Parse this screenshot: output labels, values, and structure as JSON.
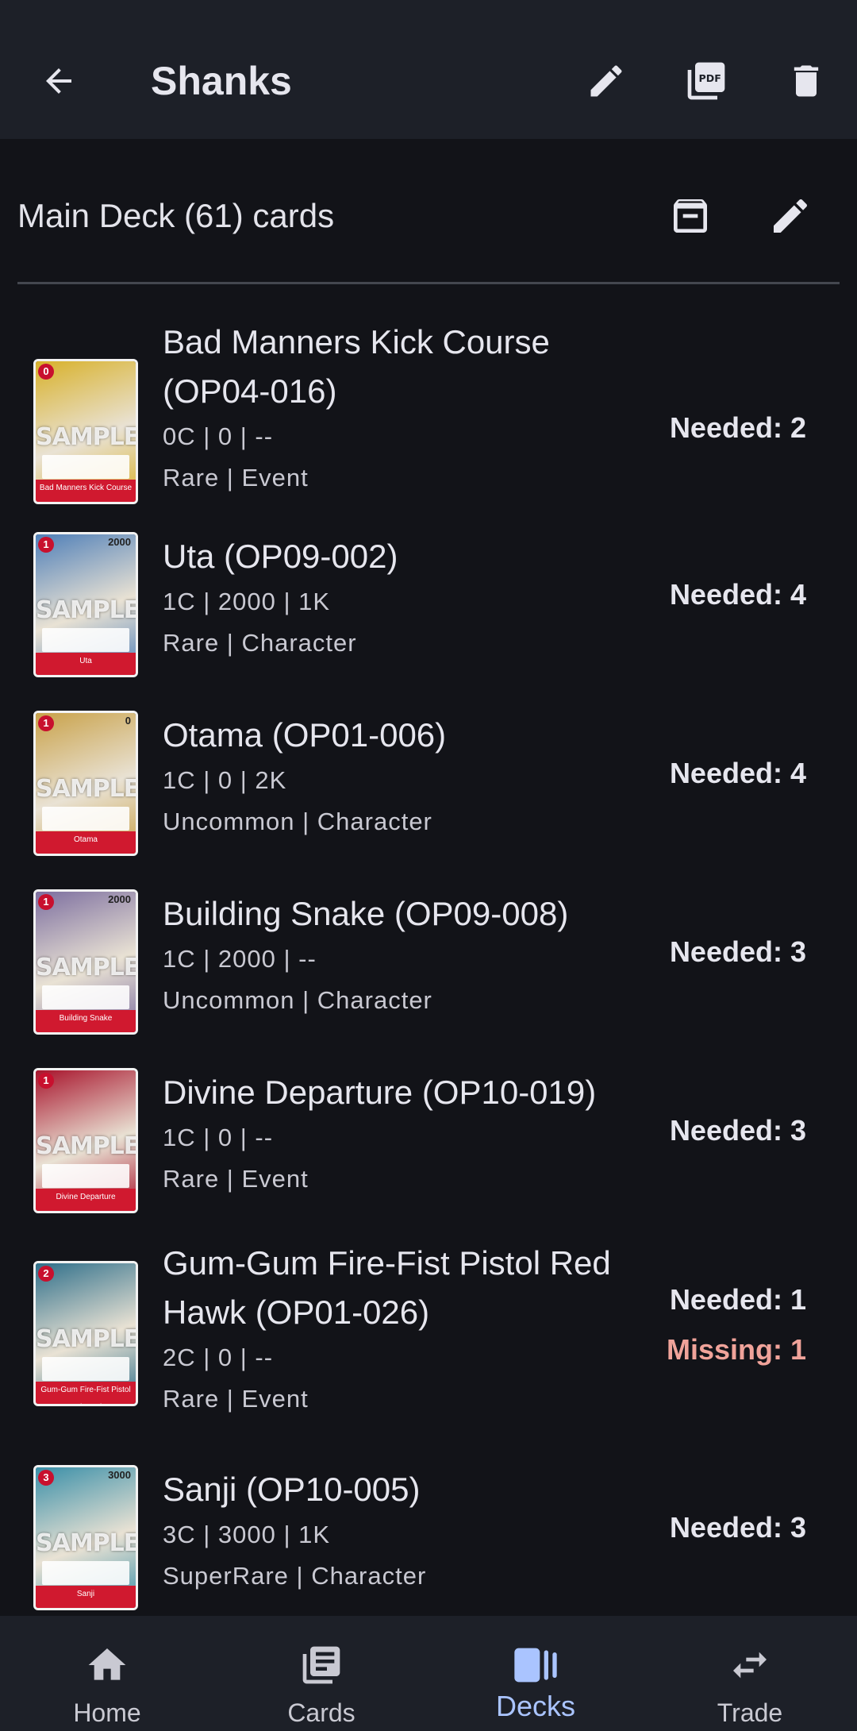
{
  "header": {
    "title": "Shanks",
    "back_icon": "arrow-left-icon",
    "actions": [
      "pencil-icon",
      "pdf-icon",
      "trash-icon"
    ]
  },
  "section": {
    "title": "Main Deck (61) cards",
    "actions": [
      "archive-icon",
      "pencil-icon"
    ]
  },
  "cards": [
    {
      "name": "Bad Manners Kick Course (OP04-016)",
      "stats": "0C | 0 | --",
      "type": "Rare | Event",
      "needed": "Needed: 2",
      "missing": "",
      "thumb_name": "Bad Manners Kick Course",
      "cost": "0",
      "power": "",
      "art_color": "#d8b12a"
    },
    {
      "name": "Uta (OP09-002)",
      "stats": "1C | 2000 | 1K",
      "type": "Rare | Character",
      "needed": "Needed: 4",
      "missing": "",
      "thumb_name": "Uta",
      "cost": "1",
      "power": "2000",
      "art_color": "#4f7fb8"
    },
    {
      "name": "Otama (OP01-006)",
      "stats": "1C | 0 | 2K",
      "type": "Uncommon | Character",
      "needed": "Needed: 4",
      "missing": "",
      "thumb_name": "Otama",
      "cost": "1",
      "power": "0",
      "art_color": "#c9a24a"
    },
    {
      "name": "Building Snake (OP09-008)",
      "stats": "1C | 2000 | --",
      "type": "Uncommon | Character",
      "needed": "Needed: 3",
      "missing": "",
      "thumb_name": "Building Snake",
      "cost": "1",
      "power": "2000",
      "art_color": "#7d6fa0"
    },
    {
      "name": "Divine Departure (OP10-019)",
      "stats": "1C | 0 | --",
      "type": "Rare | Event",
      "needed": "Needed: 3",
      "missing": "",
      "thumb_name": "Divine Departure",
      "cost": "1",
      "power": "",
      "art_color": "#a8142c"
    },
    {
      "name": "Gum-Gum Fire-Fist Pistol Red Hawk (OP01-026)",
      "stats": "2C | 0 | --",
      "type": "Rare | Event",
      "needed": "Needed: 1",
      "missing": "Missing: 1",
      "thumb_name": "Gum-Gum Fire-Fist Pistol Red Hawk",
      "cost": "2",
      "power": "",
      "art_color": "#2f6f8a"
    },
    {
      "name": "Sanji (OP10-005)",
      "stats": "3C | 3000 | 1K",
      "type": "SuperRare | Character",
      "needed": "Needed: 3",
      "missing": "",
      "thumb_name": "Sanji",
      "cost": "3",
      "power": "3000",
      "art_color": "#3a8fa8"
    }
  ],
  "thumb_watermark": "SAMPLE",
  "nav": {
    "items": [
      {
        "label": "Home",
        "icon": "home-icon"
      },
      {
        "label": "Cards",
        "icon": "cards-icon"
      },
      {
        "label": "Decks",
        "icon": "decks-icon"
      },
      {
        "label": "Trade",
        "icon": "trade-icon"
      }
    ],
    "active": "Decks"
  },
  "colors": {
    "background": "#121318",
    "bar": "#1d2028",
    "accent": "#aac4ff",
    "missing": "#f0a39a"
  }
}
